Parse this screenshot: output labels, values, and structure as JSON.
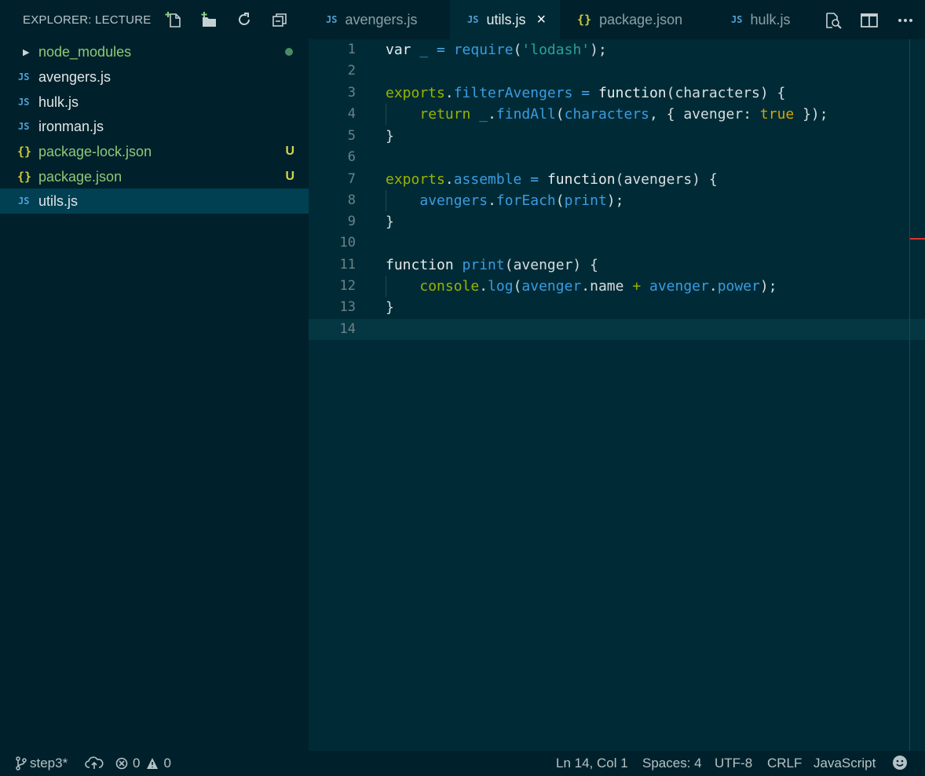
{
  "explorer": {
    "title": "EXPLORER: LECTURE",
    "actions": [
      "new-file-icon",
      "new-folder-icon",
      "refresh-icon",
      "collapse-all-icon"
    ],
    "files": [
      {
        "label": "node_modules",
        "type": "folder",
        "status": "untracked-dot"
      },
      {
        "label": "avengers.js",
        "type": "js",
        "icon": "JS"
      },
      {
        "label": "hulk.js",
        "type": "js",
        "icon": "JS"
      },
      {
        "label": "ironman.js",
        "type": "js",
        "icon": "JS"
      },
      {
        "label": "package-lock.json",
        "type": "json",
        "icon": "{}",
        "badge": "U"
      },
      {
        "label": "package.json",
        "type": "json",
        "icon": "{}",
        "badge": "U"
      },
      {
        "label": "utils.js",
        "type": "js",
        "icon": "JS",
        "active": true
      }
    ]
  },
  "tabs": [
    {
      "label": "avengers.js",
      "icon": "JS"
    },
    {
      "label": "utils.js",
      "icon": "JS",
      "active": true,
      "close": "×"
    },
    {
      "label": "package.json",
      "icon": "{}"
    },
    {
      "label": "hulk.js",
      "icon": "JS"
    }
  ],
  "tab_actions": [
    "open-preview-icon",
    "split-editor-icon",
    "more-actions-icon"
  ],
  "editor": {
    "line_numbers": [
      "1",
      "2",
      "3",
      "4",
      "5",
      "6",
      "7",
      "8",
      "9",
      "10",
      "11",
      "12",
      "13",
      "14"
    ],
    "current_line": 14,
    "code": {
      "l1": [
        "var",
        " _ ",
        "=",
        " ",
        "require",
        "(",
        "'lodash'",
        ");"
      ],
      "l3": [
        "exports",
        ".",
        "filterAvengers",
        " ",
        "=",
        " ",
        "function",
        "(characters) {"
      ],
      "l4": [
        "    ",
        "return",
        " ",
        "_",
        ".",
        "findAll",
        "(",
        "characters",
        ", { avenger: ",
        "true",
        " });"
      ],
      "l5": [
        "}"
      ],
      "l7": [
        "exports",
        ".",
        "assemble",
        " ",
        "=",
        " ",
        "function",
        "(avengers) {"
      ],
      "l8": [
        "    ",
        "avengers",
        ".",
        "forEach",
        "(",
        "print",
        ");"
      ],
      "l9": [
        "}"
      ],
      "l11": [
        "function",
        " ",
        "print",
        "(avenger) {"
      ],
      "l12": [
        "    ",
        "console",
        ".",
        "log",
        "(",
        "avenger",
        ".name ",
        "+",
        " ",
        "avenger",
        ".",
        "power",
        ");"
      ],
      "l13": [
        "}"
      ]
    }
  },
  "status": {
    "branch": "step3*",
    "errors": "0",
    "warnings": "0",
    "position": "Ln 14, Col 1",
    "spaces": "Spaces: 4",
    "encoding": "UTF-8",
    "eol": "CRLF",
    "language": "JavaScript"
  }
}
